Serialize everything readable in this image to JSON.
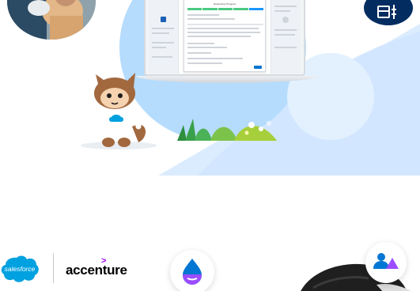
{
  "hero": {
    "dialog_title": "Opportunity Progress",
    "progress_steps": 5,
    "current_step": 5
  },
  "logos": {
    "salesforce": "salesforce",
    "accenture": "accenture",
    "accenture_mark": ">"
  },
  "icons": {
    "tool": "tools-icon",
    "drop": "drop-icon",
    "community": "community-icon"
  },
  "colors": {
    "hero_blue": "#d7ebff",
    "hero_circle": "#b5dcfd",
    "salesforce_blue": "#00a1e0",
    "accenture_purple": "#a100ff",
    "navy": "#032d60"
  }
}
